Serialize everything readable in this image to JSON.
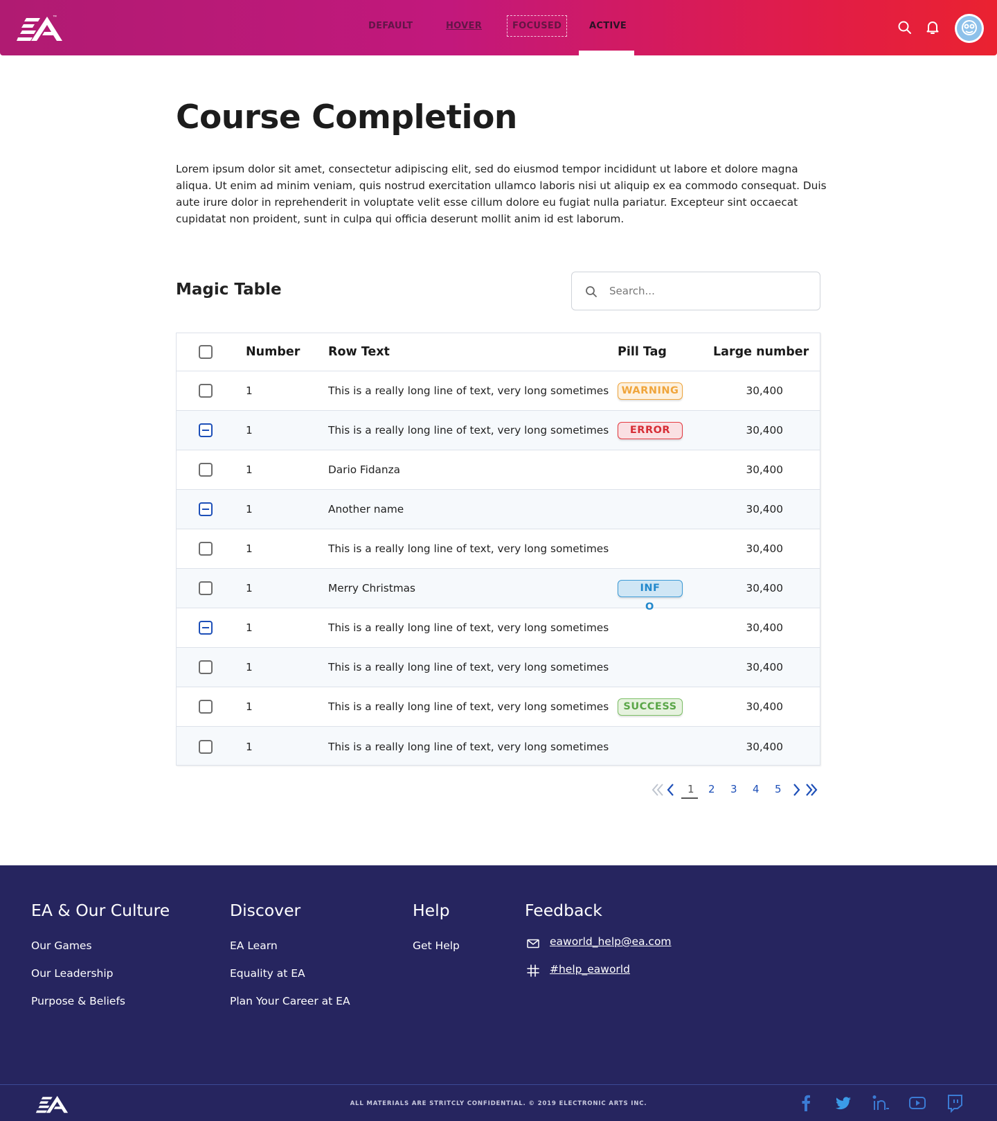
{
  "header": {
    "logo_text": "EA",
    "nav": {
      "default_label": "DEFAULT",
      "hover_label": "HOVER",
      "focused_label": "FOCUSED",
      "active_label": "ACTIVE"
    },
    "icons": [
      "search-icon",
      "bell-icon",
      "avatar"
    ]
  },
  "main": {
    "title": "Course Completion",
    "intro": "Lorem ipsum dolor sit amet, consectetur adipiscing elit, sed do eiusmod tempor incididunt ut labore et dolore magna aliqua. Ut enim ad minim veniam, quis nostrud exercitation ullamco laboris nisi ut aliquip ex ea commodo consequat. Duis aute irure dolor in reprehenderit in voluptate velit esse cillum dolore eu fugiat nulla pariatur. Excepteur sint occaecat cupidatat non proident, sunt in culpa qui officia deserunt mollit anim id est laborum.",
    "table_title": "Magic Table",
    "search_placeholder": "Search..."
  },
  "table": {
    "headers": {
      "number": "Number",
      "row_text": "Row Text",
      "pill_tag": "Pill Tag",
      "large_number": "Large number"
    },
    "rows": [
      {
        "checked": "unchecked",
        "number": "1",
        "text": "This is a really long line of text, very long sometimes",
        "pill": "WARNING",
        "pill_type": "warning",
        "large": "30,400"
      },
      {
        "checked": "indeterminate",
        "number": "1",
        "text": "This is a really long line of text, very long sometimes",
        "pill": "ERROR",
        "pill_type": "error",
        "large": "30,400"
      },
      {
        "checked": "unchecked",
        "number": "1",
        "text": "Dario Fidanza",
        "pill": "",
        "pill_type": "",
        "large": "30,400"
      },
      {
        "checked": "indeterminate",
        "number": "1",
        "text": "Another name",
        "pill": "",
        "pill_type": "",
        "large": "30,400"
      },
      {
        "checked": "unchecked",
        "number": "1",
        "text": "This is a really long line of text, very long sometimes",
        "pill": "",
        "pill_type": "",
        "large": "30,400"
      },
      {
        "checked": "unchecked",
        "number": "1",
        "text": "Merry Christmas",
        "pill": "INF",
        "pill_overflow": "O",
        "pill_type": "info",
        "large": "30,400"
      },
      {
        "checked": "indeterminate",
        "number": "1",
        "text": "This is a really long line of text, very long sometimes",
        "pill": "",
        "pill_type": "",
        "large": "30,400"
      },
      {
        "checked": "unchecked",
        "number": "1",
        "text": "This is a really long line of text, very long sometimes",
        "pill": "",
        "pill_type": "",
        "large": "30,400"
      },
      {
        "checked": "unchecked",
        "number": "1",
        "text": "This is a really long line of text, very long sometimes",
        "pill": "SUCCESS",
        "pill_type": "success",
        "large": "30,400"
      },
      {
        "checked": "unchecked",
        "number": "1",
        "text": "This is a really long line of text, very long sometimes",
        "pill": "",
        "pill_type": "",
        "large": "30,400"
      }
    ]
  },
  "pagination": {
    "pages": [
      "1",
      "2",
      "3",
      "4",
      "5"
    ],
    "current": "1"
  },
  "footer": {
    "col1": {
      "title": "EA & Our Culture",
      "links": [
        "Our Games",
        "Our Leadership",
        "Purpose & Beliefs"
      ]
    },
    "col2": {
      "title": "Discover",
      "links": [
        "EA Learn",
        "Equality at EA",
        "Plan Your Career at EA"
      ]
    },
    "col3": {
      "title": "Help",
      "links": [
        "Get Help"
      ]
    },
    "col4": {
      "title": "Feedback",
      "email": "eaworld_help@ea.com",
      "slack": "#help_eaworld"
    },
    "copyright": "ALL MATERIALS ARE STRITCLY CONFIDENTIAL. © 2019 ELECTRONIC ARTS INC.",
    "social": [
      "facebook-icon",
      "twitter-icon",
      "linkedin-icon",
      "youtube-icon",
      "twitch-icon"
    ]
  },
  "colors": {
    "header_gradient_start": "#b01b72",
    "header_gradient_end": "#ea2230",
    "footer_bg": "#26255f",
    "accent_blue": "#1d4fb8",
    "warning": "#f0a53b",
    "error": "#e5383f",
    "info": "#3c9ad6",
    "success": "#7cbf65"
  }
}
